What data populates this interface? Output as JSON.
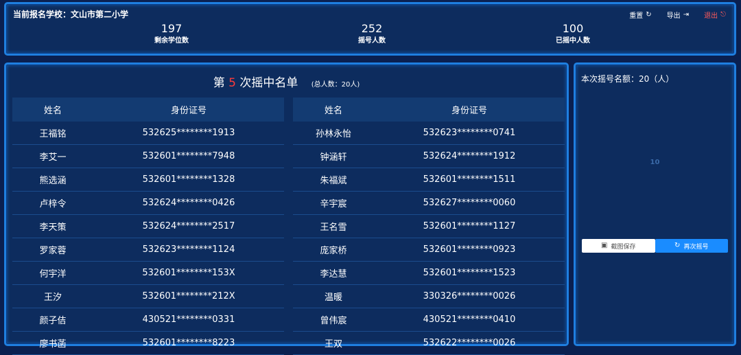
{
  "header": {
    "school_label": "当前报名学校：文山市第二小学",
    "toolbar": [
      {
        "label": "重置",
        "icon": "refresh-icon",
        "glyph": "↻"
      },
      {
        "label": "导出",
        "icon": "export-icon",
        "glyph": "⇥"
      },
      {
        "label": "退出",
        "icon": "logout-icon",
        "glyph": "⎋"
      }
    ],
    "stats": [
      {
        "value": "197",
        "label": "剩余学位数"
      },
      {
        "value": "252",
        "label": "摇号人数"
      },
      {
        "value": "100",
        "label": "已摇中人数"
      }
    ]
  },
  "main": {
    "title_prefix": "第",
    "round": "5",
    "title_suffix": "次摇中名单",
    "total": "(总人数：20人)",
    "columns": {
      "name": "姓名",
      "id": "身份证号"
    },
    "left_rows": [
      {
        "name": "王福铭",
        "id": "532625********1913"
      },
      {
        "name": "李艾一",
        "id": "532601********7948"
      },
      {
        "name": "熊选涵",
        "id": "532601********1328"
      },
      {
        "name": "卢梓令",
        "id": "532624********0426"
      },
      {
        "name": "李天策",
        "id": "532624********2517"
      },
      {
        "name": "罗家蓉",
        "id": "532623********1124"
      },
      {
        "name": "何宇洋",
        "id": "532601********153X"
      },
      {
        "name": "王汐",
        "id": "532601********212X"
      },
      {
        "name": "颜子佶",
        "id": "430521********0331"
      },
      {
        "name": "廖书菡",
        "id": "532601********8223"
      }
    ],
    "right_rows": [
      {
        "name": "孙林永怡",
        "id": "532623********0741"
      },
      {
        "name": "钟涵轩",
        "id": "532624********1912"
      },
      {
        "name": "朱福斌",
        "id": "532601********1511"
      },
      {
        "name": "辛宇宸",
        "id": "532627********0060"
      },
      {
        "name": "王名雪",
        "id": "532601********1127"
      },
      {
        "name": "庞家桥",
        "id": "532601********0923"
      },
      {
        "name": "李达慧",
        "id": "532601********1523"
      },
      {
        "name": "温暖",
        "id": "330326********0026"
      },
      {
        "name": "曾伟宸",
        "id": "430521********0410"
      },
      {
        "name": "王双",
        "id": "532622********0026"
      }
    ]
  },
  "side": {
    "quota": "本次摇号名额：20（人）",
    "ghost_number": "10",
    "save_label": "截图保存",
    "again_label": "再次摇号",
    "save_icon": "screenshot-icon",
    "again_icon": "refresh-icon"
  },
  "colors": {
    "background": "#0a2050",
    "panel": "#0d2c5e",
    "border": "#1f7fe0",
    "accent_red": "#ff3b3b",
    "button_blue": "#1a8cff"
  }
}
